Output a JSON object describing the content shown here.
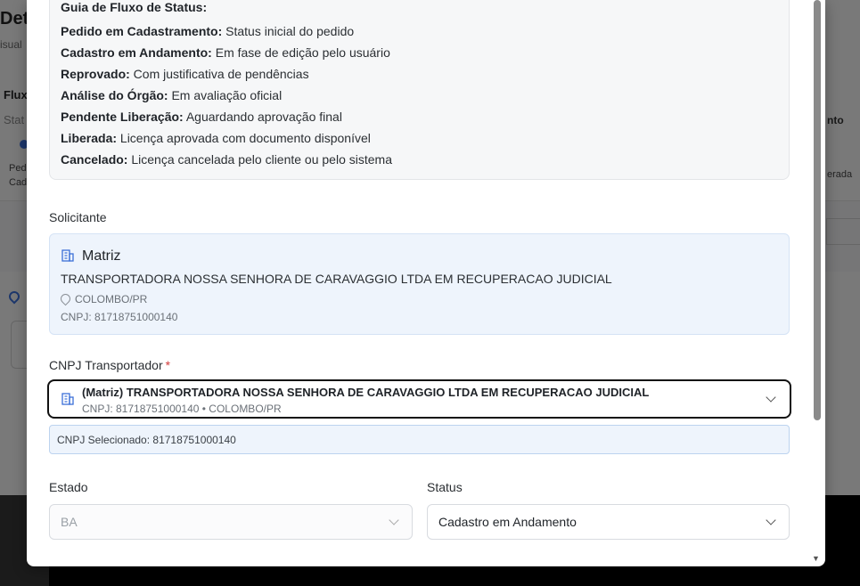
{
  "background": {
    "title": "Deta",
    "subtitle": "isual",
    "fluxo": "Flux",
    "status": "Stat",
    "step_label_1": "Ped",
    "step_label_2": "Cada",
    "right_label": "nto",
    "right_step": "erada"
  },
  "guide": {
    "title": "Guia de Fluxo de Status:",
    "items": [
      {
        "name": "Pedido em Cadastramento:",
        "desc": " Status inicial do pedido"
      },
      {
        "name": "Cadastro em Andamento:",
        "desc": " Em fase de edição pelo usuário"
      },
      {
        "name": "Reprovado:",
        "desc": " Com justificativa de pendências"
      },
      {
        "name": "Análise do Órgão:",
        "desc": " Em avaliação oficial"
      },
      {
        "name": "Pendente Liberação:",
        "desc": " Aguardando aprovação final"
      },
      {
        "name": "Liberada:",
        "desc": " Licença aprovada com documento disponível"
      },
      {
        "name": "Cancelado:",
        "desc": " Licença cancelada pelo cliente ou pelo sistema"
      }
    ]
  },
  "solicitante": {
    "label": "Solicitante",
    "type": "Matriz",
    "company": "TRANSPORTADORA NOSSA SENHORA DE CARAVAGGIO LTDA EM RECUPERACAO JUDICIAL",
    "location": "COLOMBO/PR",
    "cnpj": "CNPJ: 81718751000140"
  },
  "transportador": {
    "label": "CNPJ Transportador",
    "required_mark": "*",
    "selected_title": "(Matriz) TRANSPORTADORA NOSSA SENHORA DE CARAVAGGIO LTDA EM RECUPERACAO JUDICIAL",
    "selected_sub": "CNPJ: 81718751000140  •  COLOMBO/PR",
    "selected_info": "CNPJ Selecionado: 81718751000140"
  },
  "estado": {
    "label": "Estado",
    "value": "BA"
  },
  "status": {
    "label": "Status",
    "value": "Cadastro em Andamento"
  },
  "icons": [
    "building-icon",
    "location-pin-icon",
    "chevron-down-icon"
  ],
  "colors": {
    "accent": "#3b6fd8",
    "info_bg": "#eef4fc",
    "required": "#d23b3b"
  }
}
